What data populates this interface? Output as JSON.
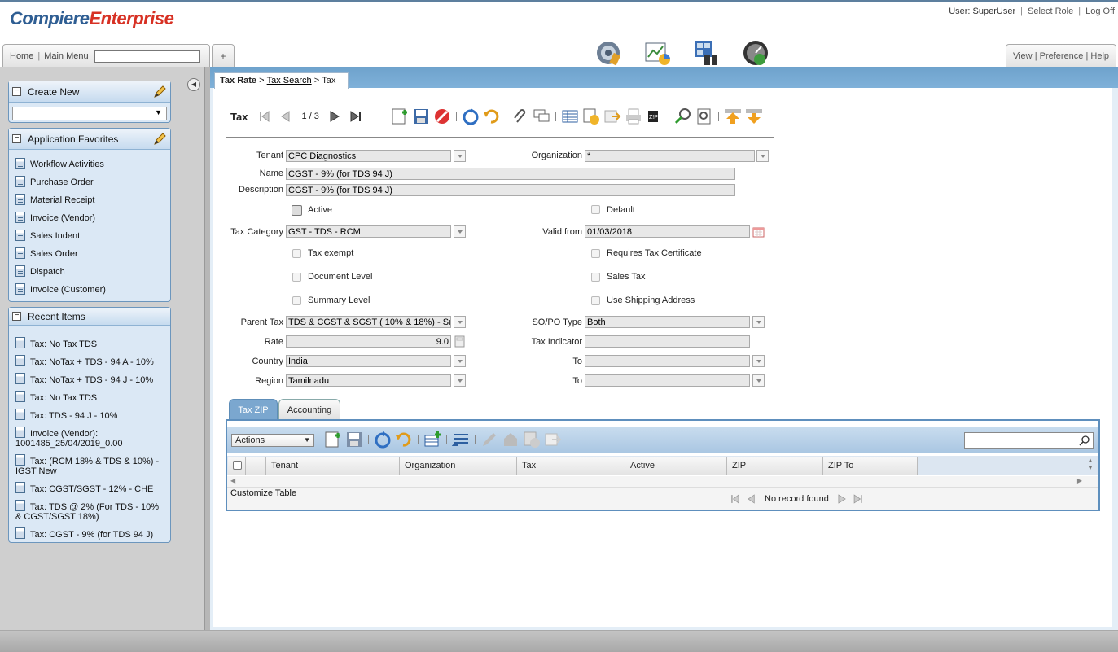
{
  "app": {
    "logo_part1": "Compiere",
    "logo_part2": "Enterprise"
  },
  "header": {
    "user_label": "User: SuperUser",
    "select_role": "Select Role",
    "log_off": "Log Off",
    "home": "Home",
    "main_menu": "Main Menu",
    "plus": "+",
    "view": "View",
    "preference": "Preference",
    "help": "Help",
    "separator": "|"
  },
  "sidebar": {
    "create_new": {
      "title": "Create New",
      "selected": ""
    },
    "favorites": {
      "title": "Application Favorites",
      "items": [
        "Workflow Activities",
        "Purchase Order",
        "Material Receipt",
        "Invoice (Vendor)",
        "Sales Indent",
        "Sales Order",
        "Dispatch",
        "Invoice (Customer)"
      ]
    },
    "recent": {
      "title": "Recent Items",
      "items": [
        "Tax: No Tax TDS",
        "Tax: NoTax + TDS - 94 A - 10%",
        "Tax: NoTax + TDS - 94 J - 10%",
        "Tax: No Tax TDS",
        "Tax: TDS - 94 J - 10%",
        "Invoice (Vendor): 1001485_25/04/2019_0.00",
        "Tax: (RCM 18% & TDS & 10%) - IGST New",
        "Tax: CGST/SGST - 12% - CHE",
        "Tax: TDS @ 2% (For TDS - 10% & CGST/SGST 18%)",
        "Tax: CGST - 9% (for TDS 94 J)"
      ]
    }
  },
  "breadcrumb": {
    "root": "Tax Rate",
    "sep": ">",
    "link": "Tax Search",
    "current": "Tax"
  },
  "toolbar": {
    "title": "Tax",
    "record_nav": "1 / 3"
  },
  "form": {
    "tenant": {
      "label": "Tenant",
      "value": "CPC Diagnostics"
    },
    "organization": {
      "label": "Organization",
      "value": "*"
    },
    "name": {
      "label": "Name",
      "value": "CGST - 9% (for TDS 94 J)"
    },
    "description": {
      "label": "Description",
      "value": "CGST - 9% (for TDS 94 J)"
    },
    "active": {
      "label": "Active",
      "checked": false
    },
    "default": {
      "label": "Default",
      "checked": false
    },
    "tax_category": {
      "label": "Tax Category",
      "value": "GST - TDS - RCM"
    },
    "valid_from": {
      "label": "Valid from",
      "value": "01/03/2018"
    },
    "tax_exempt": {
      "label": "Tax exempt",
      "checked": false
    },
    "requires_tax_certificate": {
      "label": "Requires Tax Certificate",
      "checked": false
    },
    "document_level": {
      "label": "Document Level",
      "checked": false
    },
    "sales_tax": {
      "label": "Sales Tax",
      "checked": false
    },
    "summary_level": {
      "label": "Summary Level",
      "checked": false
    },
    "use_shipping_address": {
      "label": "Use Shipping Address",
      "checked": false
    },
    "parent_tax": {
      "label": "Parent Tax",
      "value": "TDS & CGST & SGST ( 10% & 18%) - Su"
    },
    "so_po_type": {
      "label": "SO/PO Type",
      "value": "Both"
    },
    "rate": {
      "label": "Rate",
      "value": "9.0"
    },
    "tax_indicator": {
      "label": "Tax Indicator",
      "value": ""
    },
    "country": {
      "label": "Country",
      "value": "India"
    },
    "to_country": {
      "label": "To",
      "value": ""
    },
    "region": {
      "label": "Region",
      "value": "Tamilnadu"
    },
    "to_region": {
      "label": "To",
      "value": ""
    }
  },
  "tabs": [
    {
      "label": "Tax ZIP",
      "active": true
    },
    {
      "label": "Accounting",
      "active": false
    }
  ],
  "grid": {
    "actions_label": "Actions",
    "columns": [
      "Tenant",
      "Organization",
      "Tax",
      "Active",
      "ZIP",
      "ZIP To"
    ],
    "customize": "Customize Table",
    "status": "No record found"
  },
  "colors": {
    "accent": "#6ea2cc",
    "tab_active": "#7ba7cf",
    "panel_bg": "#dbe8f5",
    "logo_blue": "#2f5e93",
    "logo_red": "#d73124"
  }
}
